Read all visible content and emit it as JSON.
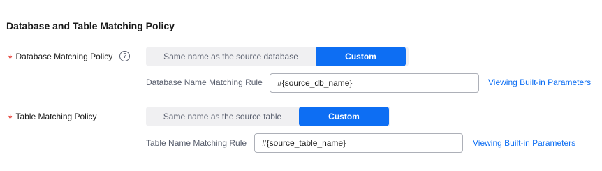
{
  "section": {
    "title": "Database and Table Matching Policy"
  },
  "database_policy": {
    "required_mark": "*",
    "label": "Database Matching Policy",
    "help_icon_glyph": "?",
    "options": [
      "Same name as the source database",
      "Custom"
    ],
    "selected": "Custom",
    "rule_label": "Database Name Matching Rule",
    "rule_value": "#{source_db_name}",
    "link": "Viewing Built-in Parameters"
  },
  "table_policy": {
    "required_mark": "*",
    "label": "Table Matching Policy",
    "options": [
      "Same name as the source table",
      "Custom"
    ],
    "selected": "Custom",
    "rule_label": "Table Name Matching Rule",
    "rule_value": "#{source_table_name}",
    "link": "Viewing Built-in Parameters"
  },
  "colors": {
    "accent": "#0d6ef3",
    "required": "#e3352c",
    "segment_bg": "#f0f0f2"
  }
}
